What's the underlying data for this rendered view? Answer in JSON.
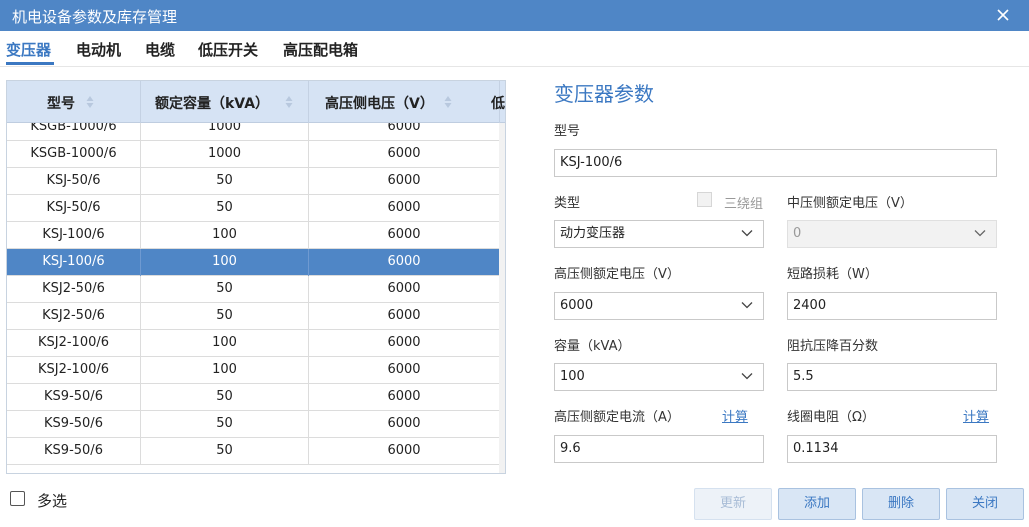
{
  "window": {
    "title": "机电设备参数及库存管理",
    "close_icon": "close-icon"
  },
  "tabs": [
    {
      "label": "变压器",
      "active": true
    },
    {
      "label": "电动机",
      "active": false
    },
    {
      "label": "电缆",
      "active": false
    },
    {
      "label": "低压开关",
      "active": false
    },
    {
      "label": "高压配电箱",
      "active": false
    }
  ],
  "table": {
    "columns": [
      "型号",
      "额定容量（kVA）",
      "高压侧电压（V）",
      "低"
    ],
    "selected_index": 5,
    "rows": [
      {
        "model": "KSGB-1000/6",
        "capacity": "1000",
        "voltage": "6000"
      },
      {
        "model": "KSGB-1000/6",
        "capacity": "1000",
        "voltage": "6000"
      },
      {
        "model": "KSJ-50/6",
        "capacity": "50",
        "voltage": "6000"
      },
      {
        "model": "KSJ-50/6",
        "capacity": "50",
        "voltage": "6000"
      },
      {
        "model": "KSJ-100/6",
        "capacity": "100",
        "voltage": "6000"
      },
      {
        "model": "KSJ-100/6",
        "capacity": "100",
        "voltage": "6000"
      },
      {
        "model": "KSJ2-50/6",
        "capacity": "50",
        "voltage": "6000"
      },
      {
        "model": "KSJ2-50/6",
        "capacity": "50",
        "voltage": "6000"
      },
      {
        "model": "KSJ2-100/6",
        "capacity": "100",
        "voltage": "6000"
      },
      {
        "model": "KSJ2-100/6",
        "capacity": "100",
        "voltage": "6000"
      },
      {
        "model": "KS9-50/6",
        "capacity": "50",
        "voltage": "6000"
      },
      {
        "model": "KS9-50/6",
        "capacity": "50",
        "voltage": "6000"
      },
      {
        "model": "KS9-50/6",
        "capacity": "50",
        "voltage": "6000"
      }
    ]
  },
  "multi_select": {
    "label": "多选",
    "checked": false
  },
  "form": {
    "title": "变压器参数",
    "model_label": "型号",
    "model_value": "KSJ-100/6",
    "type_label": "类型",
    "type_value": "动力变压器",
    "three_winding_label": "三绕组",
    "mid_voltage_label": "中压侧额定电压（V）",
    "mid_voltage_value": "0",
    "hv_voltage_label": "高压侧额定电压（V）",
    "hv_voltage_value": "6000",
    "short_loss_label": "短路损耗（W）",
    "short_loss_value": "2400",
    "capacity_label": "容量（kVA）",
    "capacity_value": "100",
    "impedance_label": "阻抗压降百分数",
    "impedance_value": "5.5",
    "hv_current_label": "高压侧额定电流（A）",
    "hv_current_value": "9.6",
    "calc_label": "计算",
    "coil_res_label": "线圈电阻（Ω）",
    "coil_res_value": "0.1134"
  },
  "buttons": {
    "update": "更新",
    "add": "添加",
    "delete": "删除",
    "close": "关闭"
  },
  "colors": {
    "accent": "#3b78c2",
    "titlebar": "#4f86c6",
    "header": "#d6e3f4",
    "selected_row": "#4f86c6"
  }
}
